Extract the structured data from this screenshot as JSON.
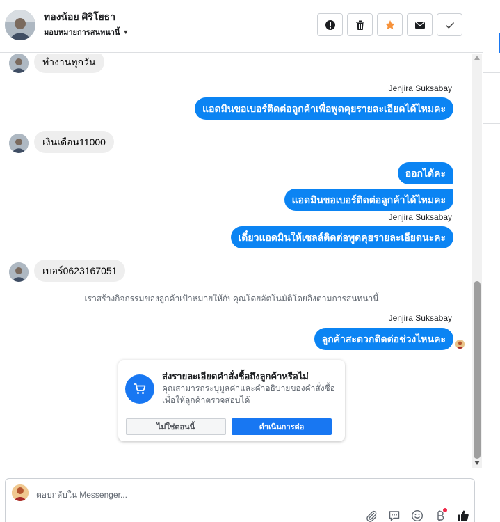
{
  "header": {
    "contact_name": "ทองน้อย ศิริโยธา",
    "assign_label": "มอบหมายการสนทนานี้",
    "actions": [
      "alert-icon",
      "trash-icon",
      "star-icon",
      "envelope-icon",
      "check-icon"
    ]
  },
  "messages": {
    "m1": "ทำงานทุกวัน",
    "sender1": "Jenjira Suksabay",
    "m2": "แอดมินขอเบอร์ติดต่อลูกค้าเพื่อพูดคุยรายละเอียดได้ไหมคะ",
    "m3": "เงินเดือน11000",
    "m4": "ออกได้คะ",
    "m5": "แอดมินขอเบอร์ติดต่อลูกค้าได้ไหมคะ",
    "sender2": "Jenjira Suksabay",
    "m6": "เดี๋ยวแอดมินให้เซลล์ติดต่อพูดคุยรายละเอียดนะคะ",
    "m7": "เบอร์0623167051",
    "system": "เราสร้างกิจกรรมของลูกค้าเป้าหมายให้กับคุณโดยอัตโนมัติโดยอิงตามการสนทนานี้",
    "sender3": "Jenjira Suksabay",
    "m8": "ลูกค้าสะดวกติดต่อช่วงไหนคะ"
  },
  "card": {
    "title": "ส่งรายละเอียดคำสั่งซื้อถึงลูกค้าหรือไม่",
    "description": "คุณสามารถระบุมูลค่าและคำอธิบายของคำสั่งซื้อเพื่อให้ลูกค้าตรวจสอบได้",
    "secondary_button": "ไม่ใช่ตอนนี้",
    "primary_button": "ดำเนินการต่อ"
  },
  "composer": {
    "placeholder": "ตอบกลับใน Messenger..."
  },
  "colors": {
    "accent": "#1877f2",
    "outgoing_bubble": "#0b84f3",
    "incoming_bubble": "#eeeeee"
  }
}
